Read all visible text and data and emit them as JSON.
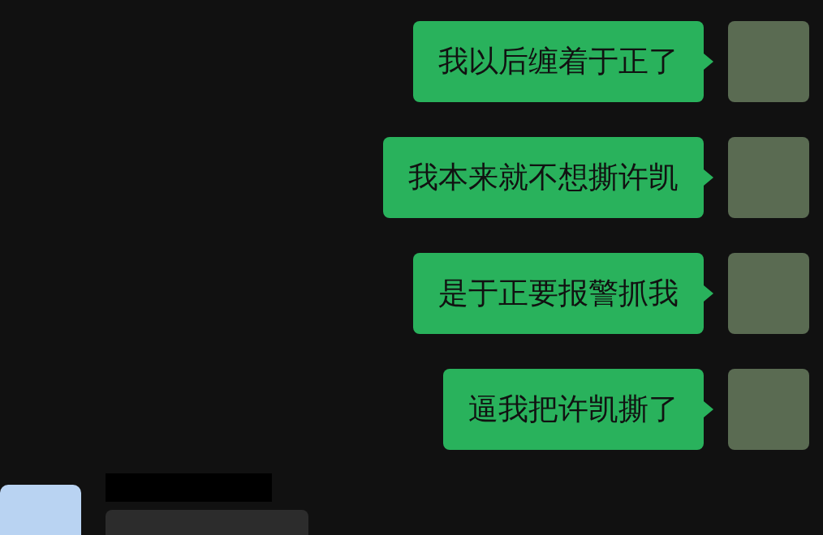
{
  "messages": [
    {
      "kind": "outgoing",
      "text": "我以后缠着于正了"
    },
    {
      "kind": "outgoing",
      "text": "我本来就不想撕许凯"
    },
    {
      "kind": "outgoing",
      "text": "是于正要报警抓我"
    },
    {
      "kind": "outgoing",
      "text": "逼我把许凯撕了"
    },
    {
      "kind": "incoming"
    }
  ]
}
